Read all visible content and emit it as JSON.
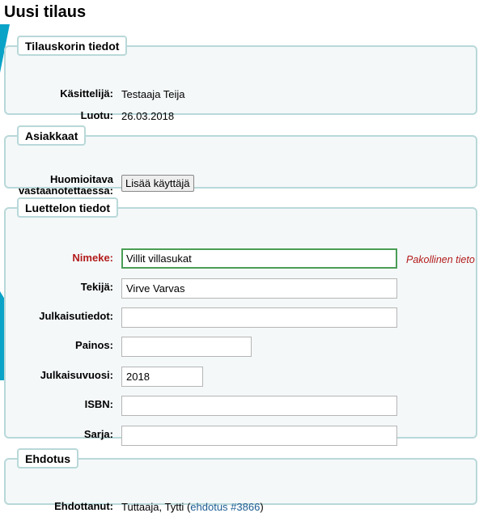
{
  "page": {
    "title": "Uusi tilaus"
  },
  "basket": {
    "legend": "Tilauskorin tiedot",
    "handler_label": "Käsittelijä:",
    "handler_value": "Testaaja Teija",
    "created_label": "Luotu:",
    "created_value": "26.03.2018"
  },
  "customers": {
    "legend": "Asiakkaat",
    "label_line1": "Huomioitava",
    "label_line2": "vastaanotettaessa:",
    "add_user_button": "Lisää käyttäjä"
  },
  "catalog": {
    "legend": "Luettelon tiedot",
    "title_label": "Nimeke:",
    "title_value": "Villit villasukat",
    "required_hint": "Pakollinen tieto",
    "author_label": "Tekijä:",
    "author_value": "Virve Varvas",
    "publication_label": "Julkaisutiedot:",
    "publication_value": "",
    "edition_label": "Painos:",
    "edition_value": "",
    "year_label": "Julkaisuvuosi:",
    "year_value": "2018",
    "isbn_label": "ISBN:",
    "isbn_value": "",
    "series_label": "Sarja:",
    "series_value": ""
  },
  "suggestion": {
    "legend": "Ehdotus",
    "suggester_label": "Ehdottanut:",
    "suggester_name": "Tuttaaja, Tytti",
    "suggestion_link": "ehdotus #3866"
  },
  "colors": {
    "accent": "#0aa3c8",
    "fieldset_border": "#b9d8d9",
    "fieldset_bg": "#f4f8f9",
    "required": "#b31b1b",
    "link": "#1b5b93",
    "focus_border": "#4a9d55"
  }
}
